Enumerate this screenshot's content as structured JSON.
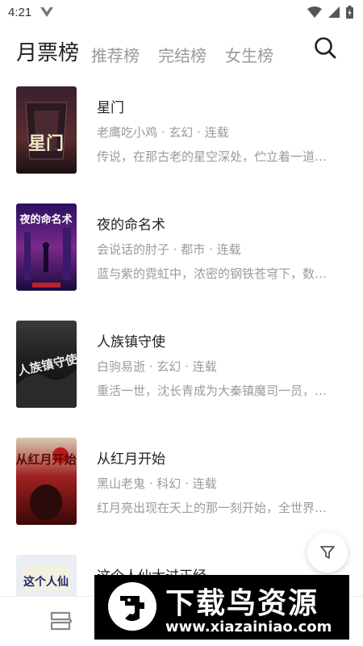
{
  "status_bar": {
    "time": "4:21"
  },
  "tabs": [
    {
      "label": "月票榜",
      "active": true
    },
    {
      "label": "推荐榜",
      "active": false
    },
    {
      "label": "完结榜",
      "active": false
    },
    {
      "label": "女生榜",
      "active": false
    }
  ],
  "books": [
    {
      "title": "星门",
      "meta": "老鹰吃小鸡 · 玄幻 · 连载",
      "desc": "传说，在那古老的星空深处，伫立着一道…",
      "cover_text": "星门"
    },
    {
      "title": "夜的命名术",
      "meta": "会说话的肘子 · 都市 · 连载",
      "desc": "蓝与紫的霓虹中，浓密的钢铁苍穹下，数…",
      "cover_text": "夜的命名术"
    },
    {
      "title": "人族镇守使",
      "meta": "白驹易逝 · 玄幻 · 连载",
      "desc": "重活一世，沈长青成为大秦镇魔司一员，…",
      "cover_text": "人族镇守使"
    },
    {
      "title": "从红月开始",
      "meta": "黑山老鬼 · 科幻 · 连载",
      "desc": "红月亮出现在天上的那一刻开始，全世界…",
      "cover_text": "从红月开始"
    },
    {
      "title": "这个人仙太过正经",
      "meta": "",
      "desc": "",
      "cover_text": "这个人仙"
    }
  ],
  "watermark": {
    "title": "下载鸟资源",
    "url": "www.xiazainiao.com"
  },
  "colors": {
    "active_tab": "#222222",
    "inactive_tab": "#9a9a9a",
    "secondary_text": "#9b9b9b"
  }
}
